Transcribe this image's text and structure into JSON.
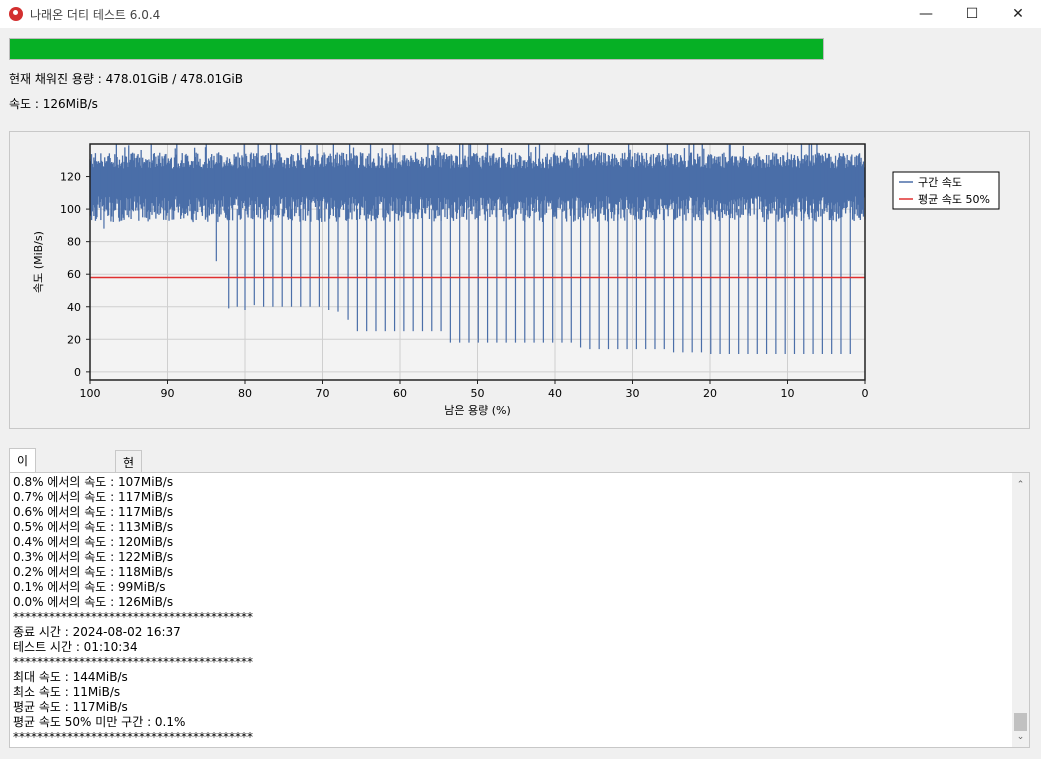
{
  "window": {
    "title": "나래온 더티 테스트 6.0.4",
    "minimize_glyph": "—",
    "maximize_glyph": "☐",
    "close_glyph": "✕"
  },
  "progress": {
    "fraction": 1.0,
    "color": "#06b025"
  },
  "status": {
    "filled": "현재 채워진 용량 : 478.01GiB / 478.01GiB",
    "speed": "속도 : 126MiB/s"
  },
  "chart_data": {
    "type": "line",
    "xlabel": "남은 용량 (%)",
    "ylabel": "속도 (MiB/s)",
    "xlim": [
      100,
      0
    ],
    "ylim": [
      -5,
      140
    ],
    "x_ticks": [
      100,
      90,
      80,
      70,
      60,
      50,
      40,
      30,
      20,
      10,
      0
    ],
    "y_ticks": [
      0,
      20,
      40,
      60,
      80,
      100,
      120
    ],
    "grid": true,
    "legend_position": "right",
    "series": [
      {
        "name": "구간 속도",
        "color": "#4a6ea8",
        "band_low": 100,
        "band_high": 128,
        "max": 144,
        "dips": [
          {
            "x": 98.2,
            "y": 88
          },
          {
            "x": 83.7,
            "y": 68
          },
          {
            "x": 82.1,
            "y": 39
          },
          {
            "x": 81.0,
            "y": 40
          },
          {
            "x": 80.0,
            "y": 38
          },
          {
            "x": 78.8,
            "y": 41
          },
          {
            "x": 77.6,
            "y": 40
          },
          {
            "x": 76.4,
            "y": 40
          },
          {
            "x": 75.2,
            "y": 40
          },
          {
            "x": 74.0,
            "y": 40
          },
          {
            "x": 72.8,
            "y": 40
          },
          {
            "x": 71.6,
            "y": 40
          },
          {
            "x": 70.4,
            "y": 40
          },
          {
            "x": 69.2,
            "y": 38
          },
          {
            "x": 68.0,
            "y": 37
          },
          {
            "x": 66.7,
            "y": 32
          },
          {
            "x": 65.5,
            "y": 25
          },
          {
            "x": 64.3,
            "y": 25
          },
          {
            "x": 63.1,
            "y": 25
          },
          {
            "x": 61.9,
            "y": 25
          },
          {
            "x": 60.7,
            "y": 25
          },
          {
            "x": 59.5,
            "y": 25
          },
          {
            "x": 58.3,
            "y": 25
          },
          {
            "x": 57.1,
            "y": 25
          },
          {
            "x": 55.9,
            "y": 25
          },
          {
            "x": 54.7,
            "y": 25
          },
          {
            "x": 53.5,
            "y": 18
          },
          {
            "x": 52.3,
            "y": 18
          },
          {
            "x": 51.1,
            "y": 18
          },
          {
            "x": 49.9,
            "y": 18
          },
          {
            "x": 48.7,
            "y": 18
          },
          {
            "x": 47.5,
            "y": 18
          },
          {
            "x": 46.3,
            "y": 18
          },
          {
            "x": 45.1,
            "y": 18
          },
          {
            "x": 43.9,
            "y": 18
          },
          {
            "x": 42.7,
            "y": 18
          },
          {
            "x": 41.5,
            "y": 18
          },
          {
            "x": 40.3,
            "y": 18
          },
          {
            "x": 39.1,
            "y": 18
          },
          {
            "x": 37.9,
            "y": 18
          },
          {
            "x": 36.7,
            "y": 15
          },
          {
            "x": 35.5,
            "y": 14
          },
          {
            "x": 34.3,
            "y": 14
          },
          {
            "x": 33.1,
            "y": 14
          },
          {
            "x": 31.9,
            "y": 14
          },
          {
            "x": 30.7,
            "y": 14
          },
          {
            "x": 29.5,
            "y": 14
          },
          {
            "x": 28.3,
            "y": 14
          },
          {
            "x": 27.1,
            "y": 14
          },
          {
            "x": 25.9,
            "y": 14
          },
          {
            "x": 24.7,
            "y": 12
          },
          {
            "x": 23.5,
            "y": 12
          },
          {
            "x": 22.3,
            "y": 12
          },
          {
            "x": 21.1,
            "y": 12
          },
          {
            "x": 19.9,
            "y": 11
          },
          {
            "x": 18.7,
            "y": 11
          },
          {
            "x": 17.5,
            "y": 11
          },
          {
            "x": 16.3,
            "y": 11
          },
          {
            "x": 15.1,
            "y": 11
          },
          {
            "x": 13.9,
            "y": 11
          },
          {
            "x": 12.7,
            "y": 11
          },
          {
            "x": 11.5,
            "y": 11
          },
          {
            "x": 10.3,
            "y": 11
          },
          {
            "x": 9.1,
            "y": 11
          },
          {
            "x": 7.9,
            "y": 11
          },
          {
            "x": 6.7,
            "y": 11
          },
          {
            "x": 5.5,
            "y": 11
          },
          {
            "x": 4.3,
            "y": 11
          },
          {
            "x": 3.1,
            "y": 11
          },
          {
            "x": 1.9,
            "y": 11
          }
        ]
      },
      {
        "name": "평균 속도 50%",
        "color": "#e03030",
        "value": 58
      }
    ]
  },
  "tabs": [
    {
      "label": "이전 + 현재 회차",
      "active": true
    },
    {
      "label": "현재 회차",
      "active": false
    }
  ],
  "log": {
    "lines": [
      "0.8% 에서의 속도 : 107MiB/s",
      "0.7% 에서의 속도 : 117MiB/s",
      "0.6% 에서의 속도 : 117MiB/s",
      "0.5% 에서의 속도 : 113MiB/s",
      "0.4% 에서의 속도 : 120MiB/s",
      "0.3% 에서의 속도 : 122MiB/s",
      "0.2% 에서의 속도 : 118MiB/s",
      "0.1% 에서의 속도 : 99MiB/s",
      "0.0% 에서의 속도 : 126MiB/s",
      "****************************************",
      "종료 시간 : 2024-08-02 16:37",
      "테스트 시간 : 01:10:34",
      "****************************************",
      "최대 속도 : 144MiB/s",
      "최소 속도 : 11MiB/s",
      "평균 속도 : 117MiB/s",
      "평균 속도 50% 미만 구간 : 0.1%",
      "****************************************"
    ],
    "scroll_up_glyph": "⌃",
    "scroll_down_glyph": "⌄"
  }
}
